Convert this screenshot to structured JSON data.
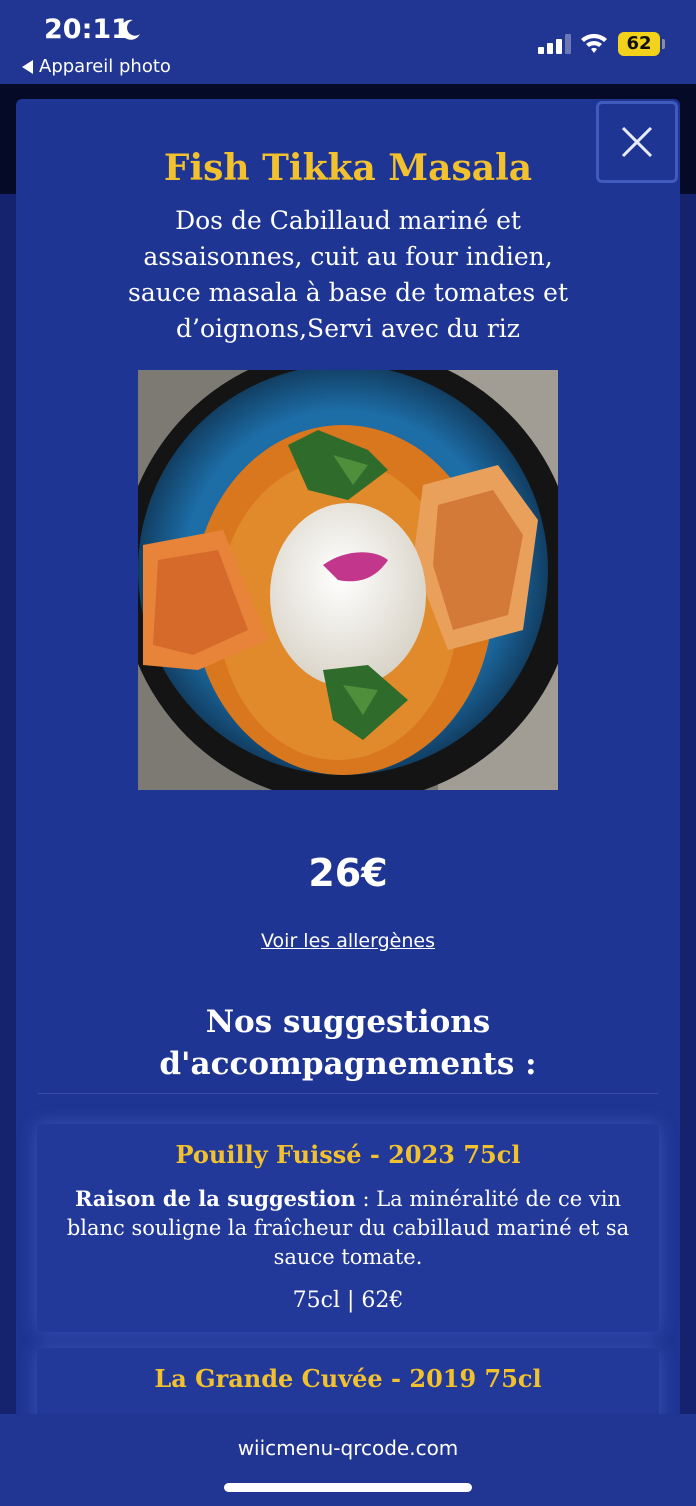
{
  "status": {
    "time": "20:11",
    "back_label": "Appareil photo",
    "battery": "62"
  },
  "dish": {
    "title": "Fish Tikka Masala",
    "description": "Dos de Cabillaud mariné et assaisonnes, cuit au four indien, sauce masala à base de tomates et d’oignons,Servi avec du riz",
    "price": "26€",
    "allergens_link": "Voir les allergènes"
  },
  "suggestions": {
    "heading": "Nos suggestions d'accompagnements :",
    "items": [
      {
        "title": "Pouilly Fuissé - 2023 75cl",
        "reason_label": "Raison de la suggestion",
        "reason_text": " : La minéralité de ce vin blanc souligne la fraîcheur du cabillaud mariné et sa sauce tomate.",
        "price": "75cl | 62€"
      },
      {
        "title": "La Grande Cuvée - 2019 75cl"
      }
    ]
  },
  "footer": {
    "url": "wiicmenu-qrcode.com"
  },
  "colors": {
    "background": "#1f3593",
    "accent": "#f2c12e",
    "battery": "#f2d21b"
  }
}
